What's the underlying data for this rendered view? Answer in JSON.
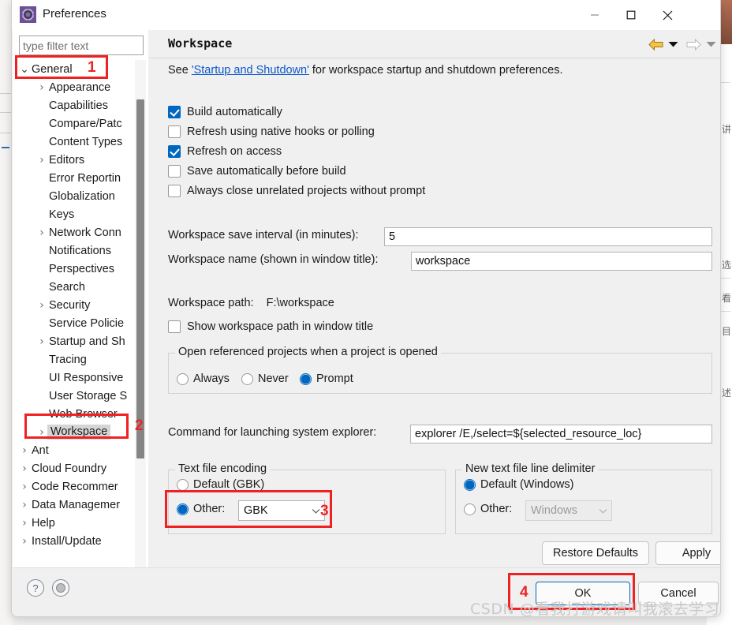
{
  "window": {
    "title": "Preferences",
    "icon": "gear-icon",
    "minimize": "—",
    "maximize": "□",
    "close": "✕"
  },
  "filter": {
    "placeholder": "type filter text",
    "value": ""
  },
  "tree": {
    "items": [
      {
        "label": "General",
        "indent": 0,
        "arrow": "down",
        "selected": false
      },
      {
        "label": "Appearance",
        "indent": 1,
        "arrow": "right",
        "selected": false
      },
      {
        "label": "Capabilities",
        "indent": 1,
        "arrow": "none",
        "selected": false
      },
      {
        "label": "Compare/Patc",
        "indent": 1,
        "arrow": "none",
        "selected": false
      },
      {
        "label": "Content Types",
        "indent": 1,
        "arrow": "none",
        "selected": false
      },
      {
        "label": "Editors",
        "indent": 1,
        "arrow": "right",
        "selected": false
      },
      {
        "label": "Error Reportin",
        "indent": 1,
        "arrow": "none",
        "selected": false
      },
      {
        "label": "Globalization",
        "indent": 1,
        "arrow": "none",
        "selected": false
      },
      {
        "label": "Keys",
        "indent": 1,
        "arrow": "none",
        "selected": false
      },
      {
        "label": "Network Conn",
        "indent": 1,
        "arrow": "right",
        "selected": false
      },
      {
        "label": "Notifications",
        "indent": 1,
        "arrow": "none",
        "selected": false
      },
      {
        "label": "Perspectives",
        "indent": 1,
        "arrow": "none",
        "selected": false
      },
      {
        "label": "Search",
        "indent": 1,
        "arrow": "none",
        "selected": false
      },
      {
        "label": "Security",
        "indent": 1,
        "arrow": "right",
        "selected": false
      },
      {
        "label": "Service Policie",
        "indent": 1,
        "arrow": "none",
        "selected": false
      },
      {
        "label": "Startup and Sh",
        "indent": 1,
        "arrow": "right",
        "selected": false
      },
      {
        "label": "Tracing",
        "indent": 1,
        "arrow": "none",
        "selected": false
      },
      {
        "label": "UI Responsive",
        "indent": 1,
        "arrow": "none",
        "selected": false
      },
      {
        "label": "User Storage S",
        "indent": 1,
        "arrow": "none",
        "selected": false
      },
      {
        "label": "Web Browser",
        "indent": 1,
        "arrow": "none",
        "selected": false
      },
      {
        "label": "Workspace",
        "indent": 1,
        "arrow": "right",
        "selected": true
      },
      {
        "label": "Ant",
        "indent": 0,
        "arrow": "right",
        "selected": false
      },
      {
        "label": "Cloud Foundry",
        "indent": 0,
        "arrow": "right",
        "selected": false
      },
      {
        "label": "Code Recommer",
        "indent": 0,
        "arrow": "right",
        "selected": false
      },
      {
        "label": "Data Managemer",
        "indent": 0,
        "arrow": "right",
        "selected": false
      },
      {
        "label": "Help",
        "indent": 0,
        "arrow": "right",
        "selected": false
      },
      {
        "label": "Install/Update",
        "indent": 0,
        "arrow": "right",
        "selected": false
      }
    ]
  },
  "page": {
    "title": "Workspace",
    "lead_prefix": "See ",
    "lead_link": "'Startup and Shutdown'",
    "lead_suffix": " for workspace startup and shutdown preferences.",
    "nav": {
      "back": "back-arrow-icon",
      "back_dropdown": "chevron-down-icon",
      "forward": "forward-arrow-icon",
      "forward_dropdown": "chevron-down-icon",
      "menu": "chevron-down-icon"
    },
    "checkboxes": [
      {
        "label": "Build automatically",
        "checked": true
      },
      {
        "label": "Refresh using native hooks or polling",
        "checked": false
      },
      {
        "label": "Refresh on access",
        "checked": true
      },
      {
        "label": "Save automatically before build",
        "checked": false
      },
      {
        "label": "Always close unrelated projects without prompt",
        "checked": false
      }
    ],
    "save_interval": {
      "label": "Workspace save interval (in minutes):",
      "value": "5"
    },
    "workspace_name": {
      "label": "Workspace name (shown in window title):",
      "value": "workspace"
    },
    "workspace_path": {
      "label": "Workspace path:",
      "value": "F:\\workspace"
    },
    "show_path_checkbox": {
      "label": "Show workspace path in window title",
      "checked": false
    },
    "open_referenced": {
      "legend": "Open referenced projects when a project is opened",
      "options": [
        {
          "label": "Always",
          "selected": false
        },
        {
          "label": "Never",
          "selected": false
        },
        {
          "label": "Prompt",
          "selected": true
        }
      ]
    },
    "system_explorer": {
      "label": "Command for launching system explorer:",
      "value": "explorer /E,/select=${selected_resource_loc}"
    },
    "text_file_encoding": {
      "legend": "Text file encoding",
      "default_option": {
        "label": "Default (GBK)",
        "selected": false
      },
      "other_option": {
        "label": "Other:",
        "selected": true
      },
      "combo_value": "GBK",
      "combo_arrow": "chevron-down-icon"
    },
    "line_delimiter": {
      "legend": "New text file line delimiter",
      "default_option": {
        "label": "Default (Windows)",
        "selected": true
      },
      "other_option": {
        "label": "Other:",
        "selected": false
      },
      "combo_value": "Windows",
      "combo_arrow": "chevron-down-icon",
      "combo_disabled": true
    },
    "restore_defaults": "Restore Defaults",
    "apply": "Apply"
  },
  "footer": {
    "help_icon": "?",
    "status_icon": "circle-icon",
    "ok": "OK",
    "cancel": "Cancel"
  },
  "annotations": [
    {
      "number": "1"
    },
    {
      "number": "2"
    },
    {
      "number": "3"
    },
    {
      "number": "4"
    }
  ],
  "watermark": "CSDN @看我打游戏请叫我滚去学习",
  "colors": {
    "accent": "#0067c0",
    "annotation_red": "#ee2222",
    "link": "#0a58ca",
    "dialog_bg": "#f0f0f0"
  }
}
